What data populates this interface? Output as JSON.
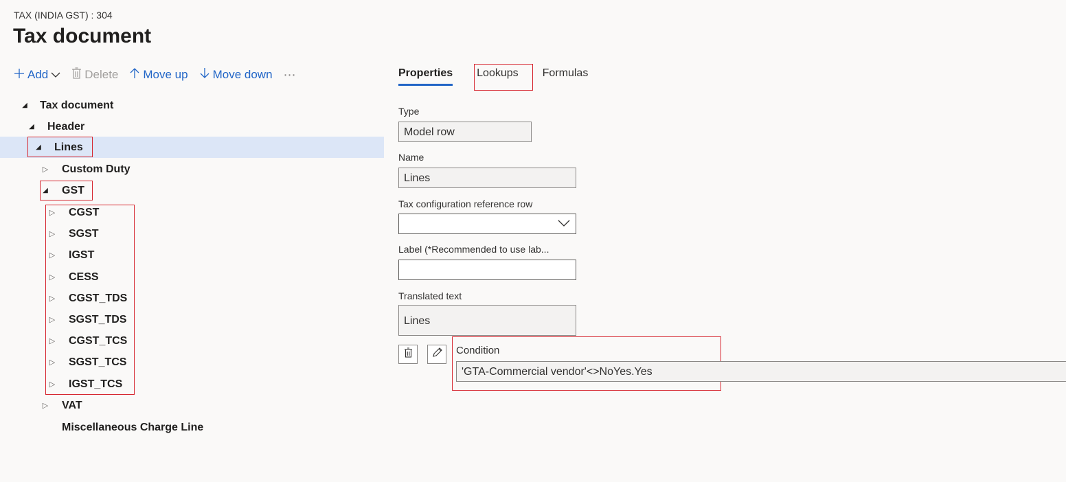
{
  "header": {
    "breadcrumb": "TAX (INDIA GST) : 304",
    "title": "Tax document"
  },
  "toolbar": {
    "add": "Add",
    "delete": "Delete",
    "move_up": "Move up",
    "move_down": "Move down",
    "more": "⋯"
  },
  "tree": {
    "root": "Tax document",
    "header": "Header",
    "lines": "Lines",
    "custom_duty": "Custom Duty",
    "gst": "GST",
    "gst_children": [
      "CGST",
      "SGST",
      "IGST",
      "CESS",
      "CGST_TDS",
      "SGST_TDS",
      "CGST_TCS",
      "SGST_TCS",
      "IGST_TCS"
    ],
    "vat": "VAT",
    "misc": "Miscellaneous Charge Line"
  },
  "tabs": {
    "properties": "Properties",
    "lookups": "Lookups",
    "formulas": "Formulas"
  },
  "form": {
    "type_label": "Type",
    "type_value": "Model row",
    "name_label": "Name",
    "name_value": "Lines",
    "ref_label": "Tax configuration reference row",
    "ref_value": "",
    "label_label": "Label (*Recommended to use lab...",
    "label_value": "",
    "translated_label": "Translated text",
    "translated_value": "Lines",
    "condition_label": "Condition",
    "condition_value": "'GTA-Commercial vendor'<>NoYes.Yes"
  },
  "colors": {
    "accent": "#2266c7",
    "selection": "#dce6f7",
    "highlight_box": "#d6262f"
  }
}
